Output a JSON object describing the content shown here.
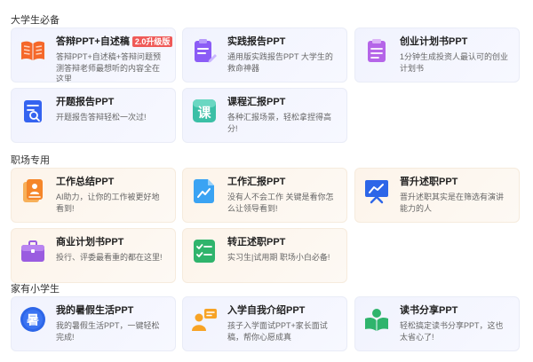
{
  "sections": {
    "student": "大学生必备",
    "work": "职场专用",
    "kids": "家有小学生"
  },
  "cards": {
    "defense": {
      "title": "答辩PPT+自述稿",
      "badge": "2.0升级版",
      "desc": "答辩PPT+自述稿+答辩问题预测答辩老师最想听的内容全在这里",
      "icon": "open-book-icon"
    },
    "practice_report": {
      "title": "实践报告PPT",
      "desc": "通用版实践报告PPT 大学生的救命神器",
      "icon": "clipboard-pen-icon"
    },
    "business_startup": {
      "title": "创业计划书PPT",
      "desc": "1分钟生成投资人最认可的创业计划书",
      "icon": "clipboard-list-icon"
    },
    "opening_report": {
      "title": "开题报告PPT",
      "desc": "开题报告答辩轻松一次过!",
      "icon": "document-search-icon"
    },
    "course_report": {
      "title": "课程汇报PPT",
      "desc": "各种汇报场景，轻松拿捏得高分!",
      "icon": "course-icon",
      "icon_text": "课"
    },
    "work_summary": {
      "title": "工作总结PPT",
      "desc": "AI助力，让你的工作被更好地看到!",
      "icon": "report-person-icon"
    },
    "work_report": {
      "title": "工作汇报PPT",
      "desc": "没有人不会工作 关键是看你怎么让领导看到!",
      "icon": "document-chart-icon"
    },
    "promotion": {
      "title": "晋升述职PPT",
      "desc": "晋升述职其实是在筛选有演讲能力的人",
      "icon": "presentation-board-icon"
    },
    "business_plan": {
      "title": "商业计划书PPT",
      "desc": "投行、评委最看重的都在这里!",
      "icon": "briefcase-icon"
    },
    "regularization": {
      "title": "转正述职PPT",
      "desc": "实习生|试用期 职场小白必备!",
      "icon": "checklist-icon"
    },
    "summer_life": {
      "title": "我的暑假生活PPT",
      "desc": "我的暑假生活PPT，一键轻松完成!",
      "icon": "summer-icon",
      "icon_text": "暑"
    },
    "self_intro": {
      "title": "入学自我介绍PPT",
      "desc": "孩子入学面试PPT+家长面试稿，帮你心愿成真",
      "icon": "person-card-icon"
    },
    "book_sharing": {
      "title": "读书分享PPT",
      "desc": "轻松搞定读书分享PPT，这也太省心了!",
      "icon": "reading-icon"
    }
  },
  "colors": {
    "orange": "#f5682a",
    "purple": "#8b5cf6",
    "violet": "#b565e8",
    "blue": "#3463f0",
    "teal": "#3bbfa6",
    "gold": "#f7a325",
    "sky": "#3aa3f3",
    "navy": "#2d66e8",
    "green": "#2fb46c"
  }
}
